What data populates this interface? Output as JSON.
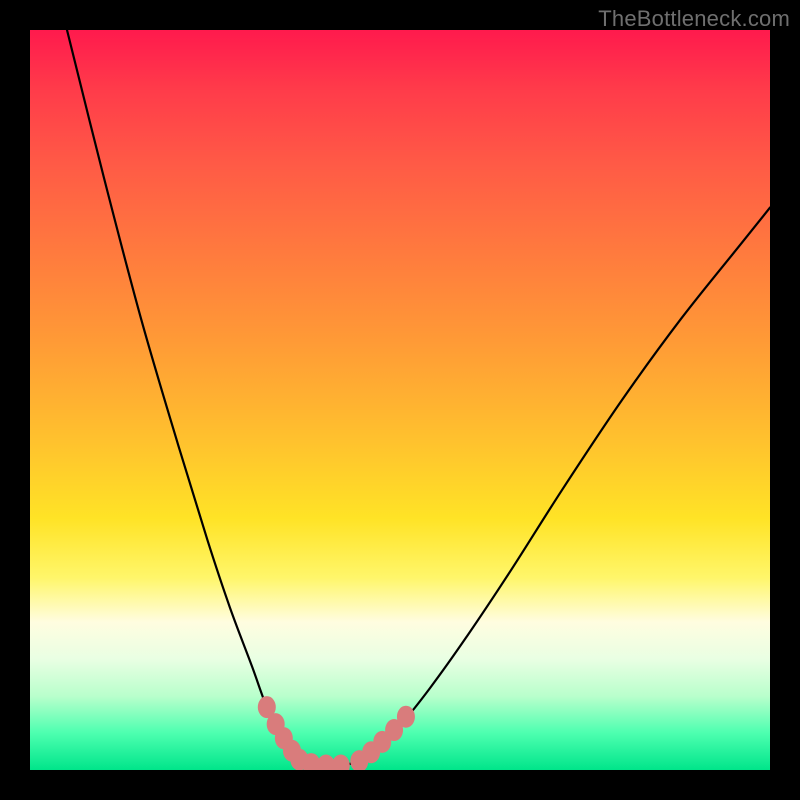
{
  "watermark": "TheBottleneck.com",
  "chart_data": {
    "type": "line",
    "title": "",
    "xlabel": "",
    "ylabel": "",
    "xlim": [
      0,
      100
    ],
    "ylim": [
      0,
      100
    ],
    "series": [
      {
        "name": "left-curve",
        "x": [
          5,
          10,
          15,
          20,
          24,
          27,
          30,
          32,
          34,
          35.5,
          37
        ],
        "values": [
          100,
          80,
          61,
          44,
          31,
          22,
          14,
          8.5,
          4.5,
          2.2,
          1
        ]
      },
      {
        "name": "right-curve",
        "x": [
          44,
          47,
          50,
          54,
          59,
          65,
          72,
          80,
          88,
          96,
          100
        ],
        "values": [
          1,
          3,
          6,
          11,
          18,
          27,
          38,
          50,
          61,
          71,
          76
        ]
      },
      {
        "name": "floor",
        "x": [
          37,
          40,
          42,
          44
        ],
        "values": [
          1,
          0.6,
          0.6,
          1
        ]
      }
    ],
    "markers": [
      {
        "series": "left-curve",
        "x": 32.0,
        "y": 8.5
      },
      {
        "series": "left-curve",
        "x": 33.2,
        "y": 6.2
      },
      {
        "series": "left-curve",
        "x": 34.3,
        "y": 4.3
      },
      {
        "series": "left-curve",
        "x": 35.4,
        "y": 2.6
      },
      {
        "series": "left-curve",
        "x": 36.4,
        "y": 1.4
      },
      {
        "series": "floor",
        "x": 38.0,
        "y": 0.8
      },
      {
        "series": "floor",
        "x": 40.0,
        "y": 0.6
      },
      {
        "series": "floor",
        "x": 42.0,
        "y": 0.6
      },
      {
        "series": "right-curve",
        "x": 44.5,
        "y": 1.2
      },
      {
        "series": "right-curve",
        "x": 46.1,
        "y": 2.4
      },
      {
        "series": "right-curve",
        "x": 47.6,
        "y": 3.8
      },
      {
        "series": "right-curve",
        "x": 49.2,
        "y": 5.4
      },
      {
        "series": "right-curve",
        "x": 50.8,
        "y": 7.2
      }
    ],
    "gradient_stops": [
      {
        "pos": 0,
        "color": "#ff1a4d"
      },
      {
        "pos": 8,
        "color": "#ff3b4a"
      },
      {
        "pos": 18,
        "color": "#ff5a46"
      },
      {
        "pos": 30,
        "color": "#ff7a3e"
      },
      {
        "pos": 42,
        "color": "#ff9a36"
      },
      {
        "pos": 55,
        "color": "#ffc02e"
      },
      {
        "pos": 66,
        "color": "#ffe326"
      },
      {
        "pos": 74,
        "color": "#fff66a"
      },
      {
        "pos": 80,
        "color": "#fffde0"
      },
      {
        "pos": 85,
        "color": "#e9ffe3"
      },
      {
        "pos": 90,
        "color": "#b9ffcc"
      },
      {
        "pos": 95,
        "color": "#4dffb0"
      },
      {
        "pos": 100,
        "color": "#00e58a"
      }
    ],
    "grid": false,
    "legend": false
  }
}
